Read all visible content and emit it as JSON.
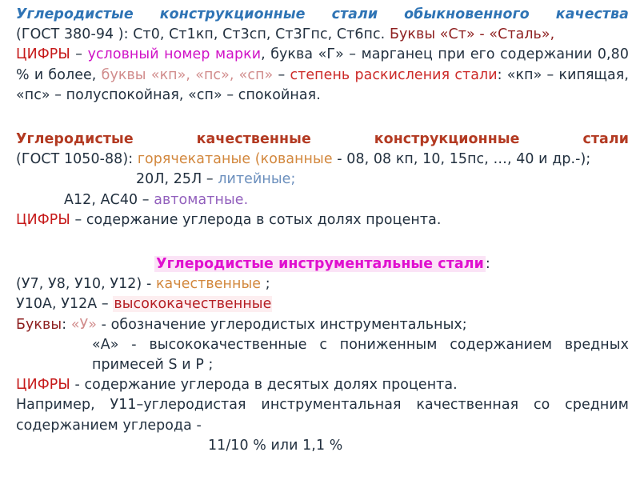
{
  "slide": {
    "language": "ru",
    "background_color": "#ffffff",
    "body_text_color": "#22303f"
  },
  "palette": {
    "title_blue": "#2f74b5",
    "heading_brick": "#b33a22",
    "heading_magenta": "#e010cf",
    "magenta_highlight_bg": "#fbe3f6",
    "maroon": "#8e2020",
    "crimson": "#c61a1a",
    "red": "#cc2a28",
    "rose": "#d18c8c",
    "magenta": "#d012c6",
    "orange": "#d2873d",
    "steel_blue": "#6b8fbd",
    "purple": "#9260bd",
    "dark_red_highlight_fg": "#b51e24",
    "dark_red_highlight_bg": "#fdeef0"
  },
  "section1": {
    "heading": "Углеродистые   конструкционные   стали   обыкновенного качества",
    "gost": " (ГОСТ 380-94 ): ",
    "grades": "Ст0, Ст1кп, Ст3сп, Ст3Гпс, Ст6пс. ",
    "letters_label": "Буквы «Ст» - «Сталь»,",
    "digits_label": "ЦИФРЫ",
    "digits_dash": " – ",
    "digits_value": "условный номер марки",
    "manganese_text": ", буква «Г» – марганец при его содержании   0,80 % и более, ",
    "deox_letters": "буквы «кп», «пс», «сп»",
    "deox_dash": " – ",
    "deox_label": "степень раскисления стали",
    "deox_explain": ": «кп» – кипящая, «пс» – полуспокойная, «сп» – спокойная."
  },
  "section2": {
    "heading": "Углеродистые   качественные   конструкционные   стали",
    "gost": " (ГОСТ 1050-88): ",
    "hot_rolled": "горячекатаные (кованные",
    "hot_rolled_grades": " - 08,   08 кп,   10,   15пс, …,  40 и др.-);",
    "cast_grades": "20Л, 25Л – ",
    "cast_label": "литейные;",
    "auto_grades": "А12, АС40 – ",
    "auto_label": "автоматные.",
    "digits_label": "ЦИФРЫ",
    "digits_text": " – содержание углерода  в сотых долях процента."
  },
  "section3": {
    "heading": "Углеродистые инструментальные стали",
    "heading_colon": ":",
    "quality_grades": "(У7, У8, У10, У12) -  ",
    "quality_label": "качественные",
    "quality_tail": " ;",
    "high_quality_grades": "У10А,  У12А – ",
    "high_quality_label": "высококачественные",
    "letters_label": "Буквы",
    "letters_colon": ":  ",
    "letter_u": "«У»",
    "letter_u_text": " - обозначение углеродистых инструментальных;",
    "letter_a_text": "«А»  -  высококачественные  с  пониженным  содержанием вредных примесей  S  и  P ;",
    "digits_label": "ЦИФРЫ",
    "digits_text": "   -   содержание  углерода  в  десятых  долях  процента.",
    "example_text": "Например,  У11–углеродистая  инструментальная  качественная   со средним содержанием углерода -",
    "example_value": "11/10 %  или  1,1 %"
  }
}
